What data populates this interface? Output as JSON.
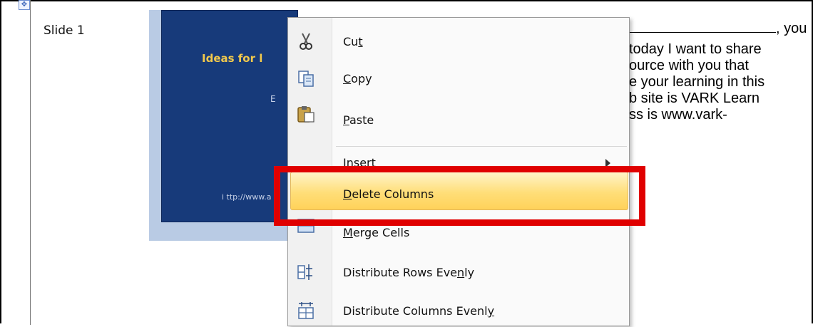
{
  "slide_label": "Slide 1",
  "slide": {
    "title": "Ideas for l",
    "subtitle": "E",
    "url": "i ttp://www.a"
  },
  "notes": {
    "lines": [
      ", you",
      "today I want to share",
      "ource with you that",
      "e your learning in this",
      "b site is VARK Learn",
      "ss is www.vark-"
    ]
  },
  "menu": {
    "items": [
      {
        "pre": "Cu",
        "u": "t",
        "post": "",
        "icon": "scissors-icon"
      },
      {
        "pre": "",
        "u": "C",
        "post": "opy",
        "icon": "copy-icon"
      },
      {
        "pre": "",
        "u": "P",
        "post": "aste",
        "icon": "paste-icon"
      },
      {
        "pre": "",
        "u": "I",
        "post": "nsert",
        "icon": "",
        "submenu": true
      },
      {
        "pre": "",
        "u": "D",
        "post": "elete Columns",
        "icon": ""
      },
      {
        "pre": "",
        "u": "M",
        "post": "erge Cells",
        "icon": "merge-cells-icon"
      },
      {
        "pre": "Distribute Rows Eve",
        "u": "n",
        "post": "ly",
        "icon": "distribute-rows-icon"
      },
      {
        "pre": "Distribute Columns Evenl",
        "u": "y",
        "post": "",
        "icon": "distribute-columns-icon"
      }
    ]
  },
  "colors": {
    "highlight_box": "#e00000",
    "slide_background": "#173a7a",
    "slide_title": "#f2c94c",
    "menu_hover": "#ffde78"
  }
}
